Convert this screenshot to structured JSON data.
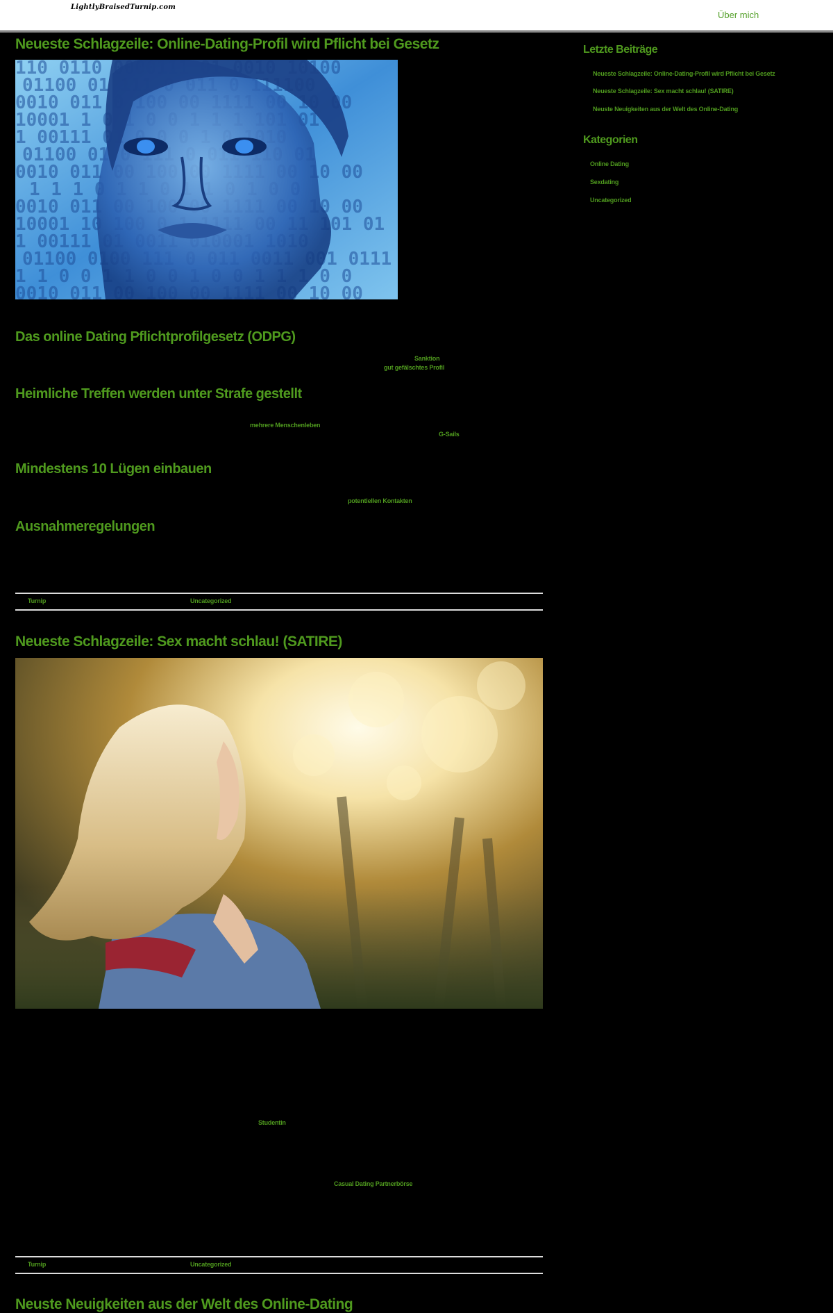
{
  "site": {
    "logo": "LightlyBraisedTurnip.com",
    "nav": {
      "about": "Über mich"
    }
  },
  "posts": [
    {
      "title": "Neueste Schlagzeile: Online-Dating-Profil wird Pflicht bei Gesetz",
      "image_alt": "digital-woman-face-binary-icon",
      "sections": [
        {
          "heading": "Das online Dating Pflichtprofilgesetz (ODPG)",
          "links": [
            "Sanktion",
            "gut gefälschtes Profil"
          ]
        },
        {
          "heading": "Heimliche Treffen werden unter Strafe gestellt",
          "links": [
            "mehrere Menschenleben",
            "G-Sails"
          ]
        },
        {
          "heading": "Mindestens 10 Lügen einbauen",
          "links": [
            "potentiellen Kontakten"
          ]
        },
        {
          "heading": "Ausnahmeregelungen",
          "links": []
        }
      ],
      "meta": {
        "author": "Turnip",
        "category": "Uncategorized"
      }
    },
    {
      "title": "Neueste Schlagzeile: Sex macht schlau! (SATIRE)",
      "image_alt": "blonde-woman-sunlight-photo",
      "links": [
        "Studentin",
        "Casual Dating Partnerbörse"
      ],
      "meta": {
        "author": "Turnip",
        "category": "Uncategorized"
      }
    },
    {
      "title": "Neuste Neuigkeiten aus der Welt des Online-Dating"
    }
  ],
  "sidebar": {
    "recent": {
      "title": "Letzte Beiträge",
      "items": [
        "Neueste Schlagzeile: Online-Dating-Profil wird Pflicht bei Gesetz",
        "Neueste Schlagzeile: Sex macht schlau! (SATIRE)",
        "Neuste Neuigkeiten aus der Welt des Online-Dating"
      ]
    },
    "categories": {
      "title": "Kategorien",
      "items": [
        "Online Dating",
        "Sexdating",
        "Uncategorized"
      ]
    }
  },
  "colors": {
    "accent": "#4f9a1e",
    "background": "#000000",
    "header": "#ffffff"
  }
}
